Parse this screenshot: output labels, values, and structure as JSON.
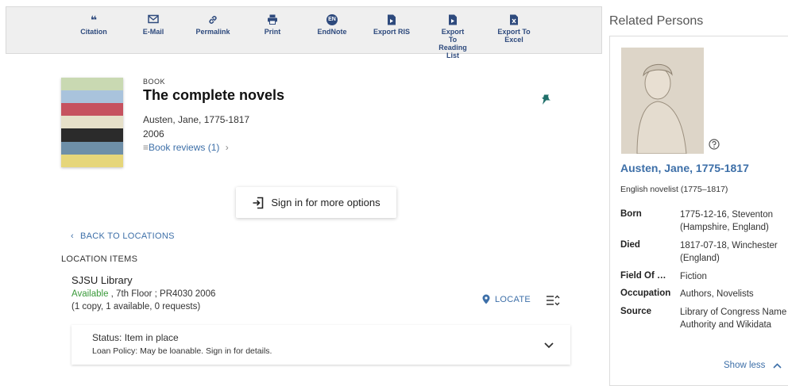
{
  "toolbar": {
    "citation": "Citation",
    "email": "E-Mail",
    "permalink": "Permalink",
    "print": "Print",
    "endnote_badge": "EN",
    "endnote": "EndNote",
    "export_ris": "Export RIS",
    "export_reading_list": "Export To Reading List",
    "export_excel": "Export To Excel"
  },
  "record": {
    "type": "BOOK",
    "title": "The complete novels",
    "author": "Austen, Jane, 1775-1817",
    "year": "2006",
    "reviews": "Book reviews (1)"
  },
  "signin": {
    "label": "Sign in for more options"
  },
  "locations": {
    "back_label": "BACK TO LOCATIONS",
    "heading": "LOCATION ITEMS",
    "library": "SJSU Library",
    "available": "Available",
    "location_detail": " , 7th Floor ; PR4030 2006",
    "copies": "(1 copy, 1 available, 0 requests)",
    "locate_label": "LOCATE",
    "status": "Status: Item in place",
    "loan_policy": "Loan Policy: May be loanable. Sign in for details."
  },
  "related": {
    "heading": "Related Persons",
    "name": "Austen, Jane, 1775-1817",
    "description": "English novelist (1775–1817)",
    "born_label": "Born",
    "born_value": "1775-12-16, Steventon (Hampshire, England)",
    "died_label": "Died",
    "died_value": "1817-07-18, Winchester (England)",
    "field_label": "Field Of …",
    "field_value": "Fiction",
    "occupation_label": "Occupation",
    "occupation_value": "Authors, Novelists",
    "source_label": "Source",
    "source_value": "Library of Congress Name Authority and Wikidata",
    "show_less": "Show less"
  },
  "colors": {
    "accent": "#3d6fa8",
    "toolbar_icon": "#2e4a7d",
    "available": "#3a9a3a",
    "pin": "#1f6f6a"
  },
  "icons": {
    "citation": "quote-icon",
    "email": "envelope-icon",
    "permalink": "link-icon",
    "print": "printer-icon",
    "export": "file-icon",
    "pin": "pushpin-icon",
    "signin": "sign-in-icon",
    "locate": "map-pin-icon",
    "sort": "sort-lines-icon",
    "expand": "chevron-down-icon",
    "help": "question-circle-icon",
    "show_less": "chevron-up-icon"
  }
}
